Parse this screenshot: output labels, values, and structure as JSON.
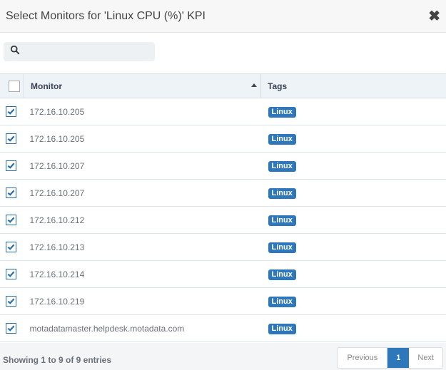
{
  "dialog": {
    "title": "Select Monitors for 'Linux CPU (%)' KPI",
    "close_icon": "close-icon"
  },
  "search": {
    "placeholder": "",
    "value": "",
    "icon": "search-icon"
  },
  "table": {
    "columns": {
      "monitor": "Monitor",
      "tags": "Tags"
    },
    "sort": {
      "column": "Monitor",
      "direction": "ascending"
    },
    "select_all_checked": false,
    "rows": [
      {
        "monitor": "172.16.10.205",
        "tag": "Linux",
        "checked": true
      },
      {
        "monitor": "172.16.10.205",
        "tag": "Linux",
        "checked": true
      },
      {
        "monitor": "172.16.10.207",
        "tag": "Linux",
        "checked": true
      },
      {
        "monitor": "172.16.10.207",
        "tag": "Linux",
        "checked": true
      },
      {
        "monitor": "172.16.10.212",
        "tag": "Linux",
        "checked": true
      },
      {
        "monitor": "172.16.10.213",
        "tag": "Linux",
        "checked": true
      },
      {
        "monitor": "172.16.10.214",
        "tag": "Linux",
        "checked": true
      },
      {
        "monitor": "172.16.10.219",
        "tag": "Linux",
        "checked": true
      },
      {
        "monitor": "motadatamaster.helpdesk.motadata.com",
        "tag": "Linux",
        "checked": true
      }
    ]
  },
  "footer": {
    "info": "Showing 1 to 9 of 9 entries",
    "pagination": {
      "previous": "Previous",
      "current": "1",
      "next": "Next"
    }
  },
  "colors": {
    "accent": "#2e77bb",
    "header_bg": "#f7f7f7",
    "table_header_bg": "#eef3f7"
  }
}
